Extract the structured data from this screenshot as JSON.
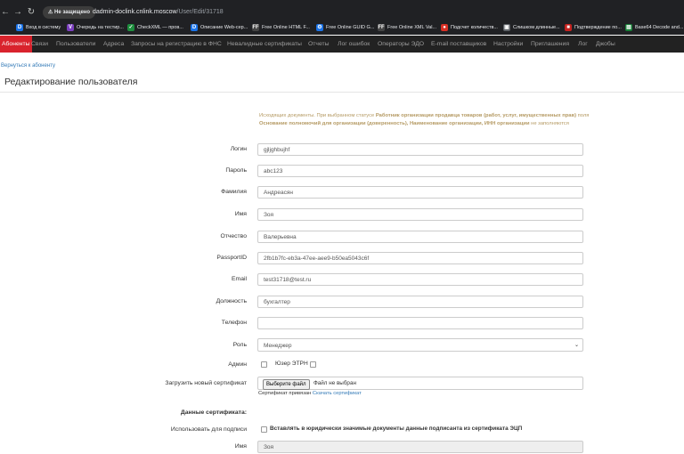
{
  "browser": {
    "security_label": "Не защищено",
    "url_host": "dadmin-doclink.cnlink.moscow",
    "url_path": "/User/Edit/31718",
    "bookmarks": [
      {
        "icon": "D",
        "label": "Вход в систему"
      },
      {
        "icon": "V",
        "label": "Очередь на тестир..."
      },
      {
        "icon": "✓",
        "label": "CheckXML — пров..."
      },
      {
        "icon": "D",
        "label": "Описание Web-сер..."
      },
      {
        "icon": "FF",
        "label": "Free Online HTML F..."
      },
      {
        "icon": "⚙",
        "label": "Free Online GUID G..."
      },
      {
        "icon": "FF",
        "label": "Free Online XML Val..."
      },
      {
        "icon": "●",
        "label": "Подсчет количеств..."
      },
      {
        "icon": "▣",
        "label": "Слишком длинные..."
      },
      {
        "icon": "■",
        "label": "Подтверждение по..."
      },
      {
        "icon": "▤",
        "label": "Base64 Decode and..."
      }
    ]
  },
  "nav": {
    "items": [
      "Абоненты",
      "Связи",
      "Пользователи",
      "Адреса",
      "Запросы на регистрацию в ФНС",
      "Невалидные сертификаты",
      "Отчеты",
      "Лог ошибок",
      "Операторы ЭДО",
      "E-mail поставщиков",
      "Настройки",
      "Приглашения",
      "Лог",
      "Джобы"
    ]
  },
  "back_link": "Вернуться к абоненту",
  "page_title": "Редактирование пользователя",
  "hint": {
    "part1": "Исходящих документы. При выбранном статусе ",
    "bold1": "Работник организации продавца товаров (работ, услуг, имущественных прав)",
    "part2": " поля ",
    "bold2": "Основание полномочий для организации (доверенность), Наименование организации, ИНН организации",
    "part3": " не заполняются"
  },
  "form": {
    "login_label": "Логин",
    "login_value": "gjljghbujhf",
    "password_label": "Пароль",
    "password_value": "abc123",
    "lastname_label": "Фамилия",
    "lastname_value": "Андреасян",
    "firstname_label": "Имя",
    "firstname_value": "Зоя",
    "patronymic_label": "Отчество",
    "patronymic_value": "Валерьевна",
    "passport_label": "PassportID",
    "passport_value": "2fb1b7fc-eb3a-47ee-aee9-b50ea5043c6f",
    "email_label": "Email",
    "email_value": "test31718@test.ru",
    "position_label": "Должность",
    "position_value": "бухгалтер",
    "phone_label": "Телефон",
    "phone_value": "",
    "role_label": "Роль",
    "role_value": "Менеджер",
    "admin_label": "Админ",
    "user_etrn_label": "Юзер ЭТРН",
    "upload_label": "Загрузить новый сертификат",
    "file_button": "Выберите файл",
    "file_none": "Файл не выбран",
    "cert_bound": "Сертификат привязан",
    "cert_download": "Скачать сертификат",
    "cert_data_label": "Данные сертификата:",
    "use_sign_label": "Использовать для подписи",
    "use_sign_text": "Вставлять в юридически значимые документы данные подписанта из сертификата ЭЦП",
    "cert_name_label": "Имя",
    "cert_name_value": "Зоя"
  }
}
